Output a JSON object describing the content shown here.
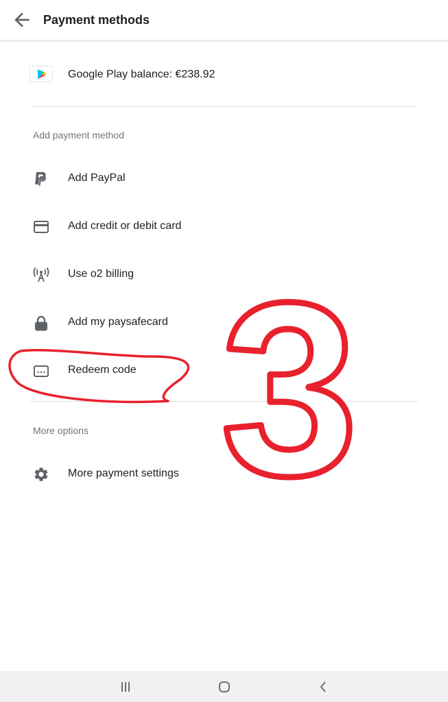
{
  "header": {
    "title": "Payment methods"
  },
  "balance": {
    "label": "Google Play balance: €238.92"
  },
  "add_section": {
    "header": "Add payment method",
    "items": [
      {
        "label": "Add PayPal",
        "icon": "paypal-icon"
      },
      {
        "label": "Add credit or debit card",
        "icon": "credit-card-icon"
      },
      {
        "label": "Use o2 billing",
        "icon": "carrier-billing-icon"
      },
      {
        "label": "Add my paysafecard",
        "icon": "lock-icon"
      },
      {
        "label": "Redeem code",
        "icon": "redeem-icon"
      }
    ]
  },
  "more_section": {
    "header": "More options",
    "items": [
      {
        "label": "More payment settings",
        "icon": "gear-icon"
      }
    ]
  },
  "annotation": {
    "step_number": "3",
    "color": "#e8212c"
  },
  "colors": {
    "primary_text": "#202124",
    "secondary_text": "#70757a",
    "icon": "#5f6368",
    "divider": "#e0e0e0"
  }
}
